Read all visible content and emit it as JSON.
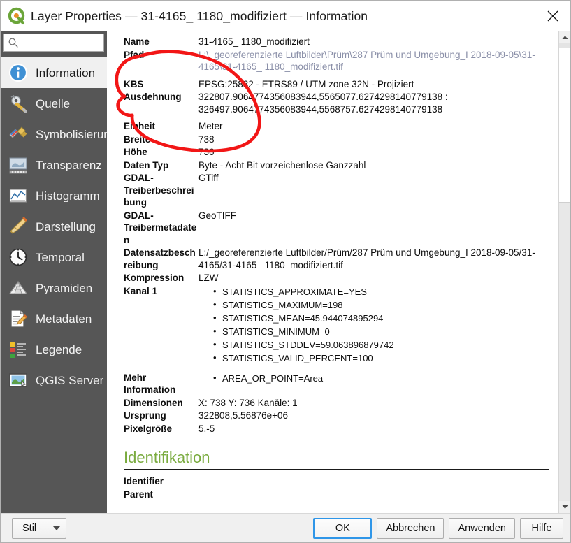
{
  "window": {
    "app_icon": "qgis-logo-icon",
    "title": "Layer Properties — 31-4165_ 1180_modifiziert — Information",
    "close_label": "✕"
  },
  "sidebar": {
    "search": {
      "icon": "search-icon",
      "value": "",
      "placeholder": ""
    },
    "items": [
      {
        "label": "Information",
        "icon": "information-icon",
        "selected": true
      },
      {
        "label": "Quelle",
        "icon": "source-icon",
        "selected": false
      },
      {
        "label": "Symbolisierung",
        "icon": "symbology-icon",
        "selected": false
      },
      {
        "label": "Transparenz",
        "icon": "transparency-icon",
        "selected": false
      },
      {
        "label": "Histogramm",
        "icon": "histogram-icon",
        "selected": false
      },
      {
        "label": "Darstellung",
        "icon": "rendering-icon",
        "selected": false
      },
      {
        "label": "Temporal",
        "icon": "clock-icon",
        "selected": false
      },
      {
        "label": "Pyramiden",
        "icon": "pyramids-icon",
        "selected": false
      },
      {
        "label": "Metadaten",
        "icon": "metadata-icon",
        "selected": false
      },
      {
        "label": "Legende",
        "icon": "legend-icon",
        "selected": false
      },
      {
        "label": "QGIS Server",
        "icon": "qgis-server-icon",
        "selected": false
      }
    ]
  },
  "information": {
    "rows": [
      {
        "key": "Name",
        "value": "31-4165_ 1180_modifiziert",
        "kind": "text"
      },
      {
        "key": "Pfad",
        "value": "L:\\_georeferenzierte Luftbilder\\Prüm\\287 Prüm und Umgebung_I 2018-09-05\\31-4165\\31-4165_ 1180_modifiziert.tif",
        "kind": "link"
      },
      {
        "key": "KBS",
        "value": "EPSG:25832 - ETRS89 / UTM zone 32N - Projiziert",
        "kind": "text"
      },
      {
        "key": "Ausdehnung",
        "value": "322807.9064774356083944,5565077.6274298140779138 : 326497.9064774356083944,5568757.6274298140779138",
        "kind": "text"
      },
      {
        "key": "Einheit",
        "value": "Meter",
        "kind": "text"
      },
      {
        "key": "Breite",
        "value": "738",
        "kind": "text"
      },
      {
        "key": "Höhe",
        "value": "736",
        "kind": "text"
      },
      {
        "key": "Daten Typ",
        "value": "Byte - Acht Bit vorzeichenlose Ganzzahl",
        "kind": "text"
      },
      {
        "key": "GDAL-Treiberbeschreibung",
        "value": "GTiff",
        "kind": "text"
      },
      {
        "key": "GDAL-Treibermetadaten",
        "value": "GeoTIFF",
        "kind": "text"
      },
      {
        "key": "Datensatzbeschreibung",
        "value": "L:/_georeferenzierte Luftbilder/Prüm/287 Prüm und Umgebung_I 2018-09-05/31-4165/31-4165_ 1180_modifiziert.tif",
        "kind": "text"
      },
      {
        "key": "Kompression",
        "value": "LZW",
        "kind": "text"
      }
    ],
    "band": {
      "key": "Kanal 1",
      "items": [
        "STATISTICS_APPROXIMATE=YES",
        "STATISTICS_MAXIMUM=198",
        "STATISTICS_MEAN=45.944074895294",
        "STATISTICS_MINIMUM=0",
        "STATISTICS_STDDEV=59.063896879742",
        "STATISTICS_VALID_PERCENT=100"
      ]
    },
    "more": {
      "key": "Mehr Information",
      "items": [
        "AREA_OR_POINT=Area"
      ]
    },
    "tail_rows": [
      {
        "key": "Dimensionen",
        "value": "X: 738 Y: 736 Kanäle: 1"
      },
      {
        "key": "Ursprung",
        "value": "322808,5.56876e+06"
      },
      {
        "key": "Pixelgröße",
        "value": "5,-5"
      }
    ],
    "identification": {
      "heading": "Identifikation",
      "rows": [
        {
          "key": "Identifier",
          "value": ""
        },
        {
          "key": "Parent",
          "value": ""
        }
      ]
    },
    "annotation": {
      "shape": "red-ellipse-highlight",
      "color": "#f21616"
    }
  },
  "scrollbar": {
    "up_arrow": "scroll-up-icon",
    "down_arrow": "scroll-down-icon"
  },
  "buttonbar": {
    "style_label": "Stil",
    "ok_label": "OK",
    "cancel_label": "Abbrechen",
    "apply_label": "Anwenden",
    "help_label": "Hilfe"
  },
  "colors": {
    "sidebar_bg": "#565656",
    "accent_green": "#7aab3f",
    "default_button_border": "#2f96e8",
    "annotation_red": "#f21616"
  }
}
